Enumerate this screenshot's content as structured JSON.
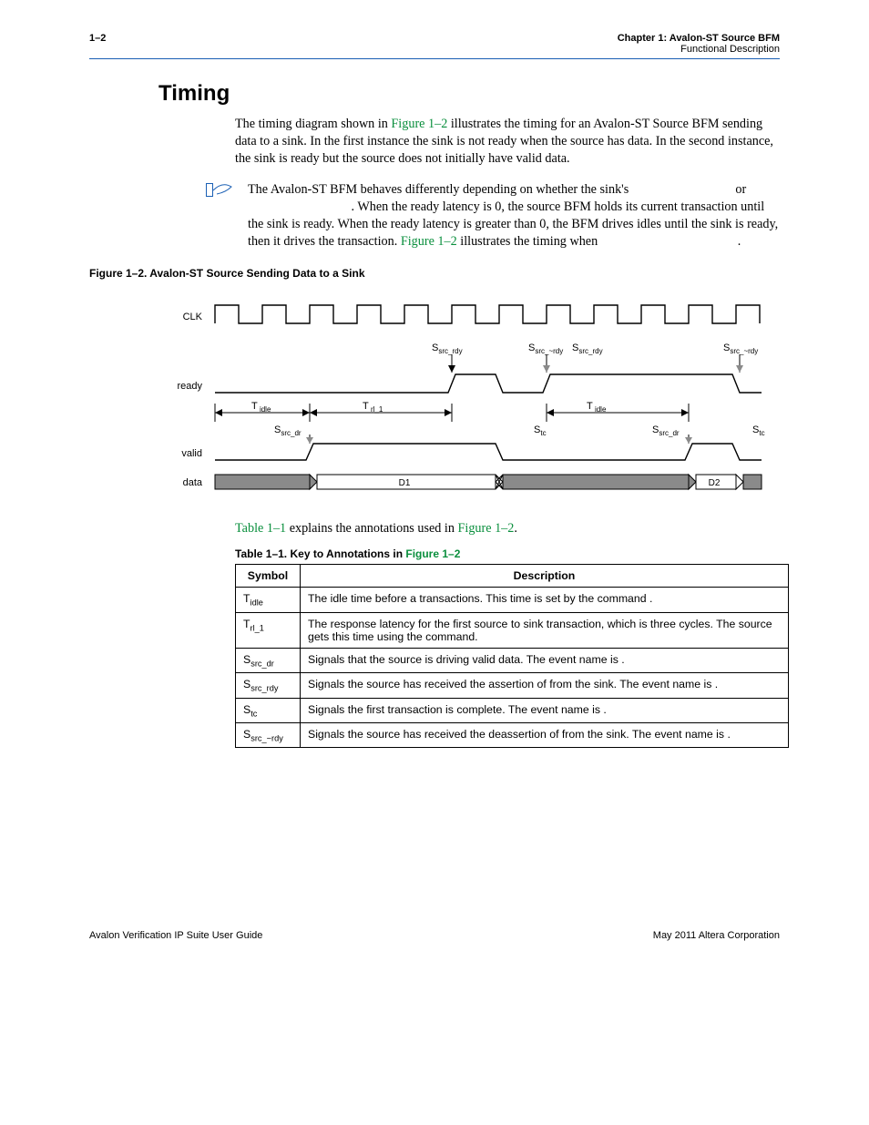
{
  "header": {
    "page_num": "1–2",
    "chapter_line": "Chapter 1: Avalon-ST Source BFM",
    "sub_line": "Functional Description"
  },
  "section_title": "Timing",
  "para1_a": "The timing diagram shown in ",
  "para1_link": "Figure 1–2",
  "para1_b": " illustrates the timing for an Avalon-ST Source BFM sending data to a sink. In the first instance the sink is not ready when the source has data. In the second instance, the sink is ready but the source does not initially have valid data.",
  "note_a": "The Avalon-ST BFM behaves differently depending on whether the sink's ",
  "note_b": " or ",
  "note_c": ". When the ready latency is 0, the source BFM holds its current transaction until the sink is ready. When the ready latency is greater than 0, the BFM drives idles until the sink is ready, then it drives the transaction. ",
  "note_link2": "Figure 1–2",
  "note_d": " illustrates the timing when ",
  "note_e": ".",
  "figure_caption_a": "Figure 1–2. Avalon-ST Source Sending Data to a Sink",
  "table_intro_a": "Table 1–1",
  "table_intro_b": " explains the annotations used in ",
  "table_intro_link": "Figure 1–2",
  "table_intro_c": ".",
  "table_caption_a": "Table 1–1. Key to Annotations in ",
  "table_caption_link": "Figure 1–2",
  "table": {
    "head_symbol": "Symbol",
    "head_desc": "Description",
    "rows": [
      {
        "sym_html": "T<span class='sub'>idle</span>",
        "desc": "The idle time before a transactions. This time is set by the command ."
      },
      {
        "sym_html": "T<span class='sub'>rl_1</span>",
        "desc": "The response latency for the first source to sink transaction, which is three cycles. The source gets this time using the                                        command."
      },
      {
        "sym_html": "S<span class='sub'>src_dr</span>",
        "desc": "Signals that the source is driving valid data. The event name is ."
      },
      {
        "sym_html": "S<span class='sub'>src_rdy</span>",
        "desc": "Signals the source has received the assertion of            from the sink. The event name is ."
      },
      {
        "sym_html": "S<span class='sub'>tc</span>",
        "desc": "Signals the first transaction is complete. The event name is ."
      },
      {
        "sym_html": "S<span class='sub'>src_~rdy</span>",
        "desc": "Signals the source has received the deassertion of            from the sink. The event name is                            ."
      }
    ]
  },
  "diagram": {
    "labels": {
      "clk": "CLK",
      "ready": "ready",
      "valid": "valid",
      "data": "data",
      "d1": "D1",
      "d2": "D2",
      "t_idle": "T",
      "t_idle_sub": " idle",
      "t_rl1": "T",
      "t_rl1_sub": " rl_1",
      "s_src_rdy": "S",
      "s_src_rdy_sub": "src_rdy",
      "s_src_nrdy": "S",
      "s_src_nrdy_sub": "src_~rdy",
      "s_src_dr": "S",
      "s_src_dr_sub": "src_dr",
      "s_tc": "S",
      "s_tc_sub": "tc"
    }
  },
  "footer": {
    "left": "Avalon Verification IP Suite User Guide",
    "right": "May 2011   Altera Corporation"
  }
}
